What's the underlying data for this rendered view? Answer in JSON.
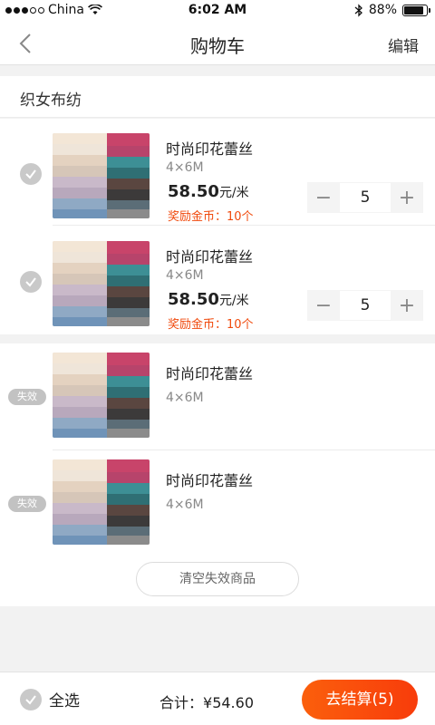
{
  "status_bar": {
    "carrier": "China",
    "time": "6:02 AM",
    "battery": "88%",
    "battery_level": 0.88,
    "icons": [
      "signal-icon",
      "wifi-icon",
      "bluetooth-icon",
      "battery-icon"
    ]
  },
  "nav": {
    "back_icon": "back-arrow-icon",
    "title": "购物车",
    "edit_label": "编辑"
  },
  "shop": {
    "name": "织女布纺"
  },
  "items": [
    {
      "title": "时尚印花蕾丝",
      "spec": "4×6M",
      "price": "58.50",
      "price_unit": "元/米",
      "reward": "奖励金币：10个",
      "quantity": "5",
      "decrement": "−",
      "increment": "+",
      "checked": true
    },
    {
      "title": "时尚印花蕾丝",
      "spec": "4×6M",
      "price": "58.50",
      "price_unit": "元/米",
      "reward": "奖励金币：10个",
      "quantity": "5",
      "decrement": "−",
      "increment": "+",
      "checked": true
    }
  ],
  "invalid_items": [
    {
      "badge": "失效",
      "title": "时尚印花蕾丝",
      "spec": "4×6M"
    },
    {
      "badge": "失效",
      "title": "时尚印花蕾丝",
      "spec": "4×6M"
    }
  ],
  "clear_invalid_label": "清空失效商品",
  "bottom": {
    "select_all_label": "全选",
    "total_label": "合计：",
    "total_value": "¥54.60",
    "checkout_label": "去结算(5)"
  },
  "colors": {
    "accent": "#f84e0c",
    "reward_text": "#f04a0d",
    "check_gray": "#c9c9c9"
  }
}
